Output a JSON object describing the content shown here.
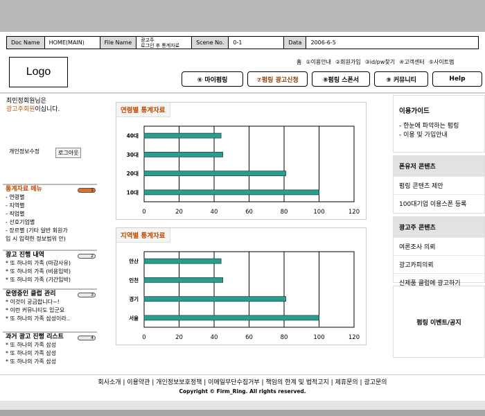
{
  "docbar": {
    "doc_label": "Doc Name",
    "doc_value": "HOME(MAIN)",
    "file_label": "File  Name",
    "file_value_1": "광고주",
    "file_value_2": "로그인 후 통계자료",
    "scene_label": "Scene No.",
    "scene_value": "0-1",
    "data_label": "Data",
    "data_value": "2006-6-5"
  },
  "logo": "Logo",
  "util_nav": [
    "홈",
    "①이용안내",
    "②회원가입",
    "③id/pw찾기",
    "④고객센터",
    "⑤사이트맵"
  ],
  "main_nav": [
    "⑥ 마이펌링",
    "⑦펌링 광고신청",
    "⑧펌링 스폰서",
    "⑨ 커뮤니티",
    "Help"
  ],
  "greeting": {
    "line1": "최민정회원님은",
    "member_type": "광고주회원",
    "suffix": "이십니다."
  },
  "my_info": "개인정보수정",
  "logout": "로그아웃",
  "left_boxes": [
    {
      "title": "통계자료 메뉴",
      "num": "1",
      "items": [
        "- 연령별",
        "- 지역별",
        "- 직업별",
        "- 선호기업별",
        "- 장르별 (기타 일반 회원가",
        "입 시  입력한 정보범위 안)"
      ]
    },
    {
      "title": "광고 진행 내역",
      "num": "2",
      "items": [
        "* 또 하나의 가족 (마감사유)",
        "* 또 하나의 가족 (비용입박)",
        "* 또 하나의 가족 (기간입박)"
      ]
    },
    {
      "title": "운영중인 클럽 관리",
      "num": "3",
      "items": [
        "* 이것이 궁금합니다~!",
        "* 이런 커뮤니티도 있군요",
        "* 또 하나의 가족 삼성이라.."
      ]
    },
    {
      "title": "과거 광고 진행 리스트",
      "num": "4",
      "items": [
        "* 또 하나의 가족 삼성",
        "* 또 하나의 가족 삼성",
        "* 또 하나의 가족 삼성"
      ]
    }
  ],
  "chart_data": [
    {
      "type": "bar",
      "title": "연령별 통계자료",
      "categories": [
        "40대",
        "30대",
        "20대",
        "10대"
      ],
      "values": [
        44,
        45,
        81,
        100
      ],
      "xlim": [
        0,
        120
      ],
      "xticks": [
        "0",
        "20",
        "40",
        "60",
        "80",
        "100",
        "120"
      ],
      "orientation": "horizontal",
      "grid": "vertical",
      "color": "#2a9d8f"
    },
    {
      "type": "bar",
      "title": "지역별 통계자료",
      "categories": [
        "안산",
        "인천",
        "경기",
        "서울"
      ],
      "values": [
        44,
        45,
        81,
        100
      ],
      "xlim": [
        0,
        120
      ],
      "xticks": [
        "0",
        "20",
        "40",
        "60",
        "80",
        "100",
        "120"
      ],
      "orientation": "horizontal",
      "grid": "vertical",
      "color": "#2a9d8f"
    }
  ],
  "right_sections": [
    {
      "head": "이용가이드",
      "items": [
        "- 한눈에 파악하는 펌링",
        "- 이용 및 가입안내"
      ]
    },
    {
      "head": "폰유저 콘텐츠",
      "items": [
        "펌링 콘텐츠 제안",
        "100대기업 이용스폰 등록"
      ]
    },
    {
      "head": "광고주 콘텐츠",
      "items": [
        "여론조사 의뢰",
        "광고카피의뢰",
        "신제품 클럽에 광고하기"
      ]
    },
    {
      "head": "펌링 이벤트/공지",
      "items": []
    }
  ],
  "footer": {
    "links": "회사소개   |  이용약관  |  개인정보보호정책  |  이메일무단수집거부  |  책임의 한계 및 법적고지  |  제휴문의  |  광고문의",
    "copyright": "Copyright  © Firm_Ring.  All rights reserved."
  }
}
